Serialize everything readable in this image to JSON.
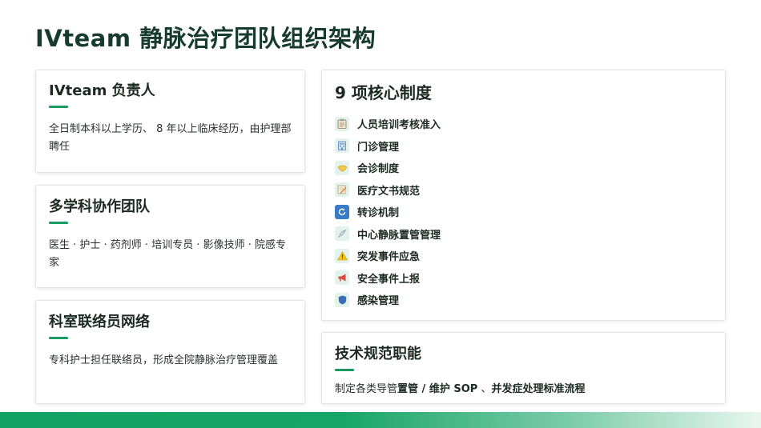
{
  "title": "IVteam 静脉治疗团队组织架构",
  "lead": {
    "title": "IVteam 负责人",
    "text": "全日制本科以上学历、 8 年以上临床经历，由护理部聘任"
  },
  "mdt": {
    "title": "多学科协作团队",
    "text": "医生 · 护士 · 药剂师 · 培训专员 · 影像技师 · 院感专家"
  },
  "liaison": {
    "title": "科室联络员网络",
    "text": "专科护士担任联络员，形成全院静脉治疗管理覆盖"
  },
  "rules": {
    "title": "9 项核心制度",
    "items": [
      {
        "label": "人员培训考核准入",
        "icon": "clipboard-icon"
      },
      {
        "label": "门诊管理",
        "icon": "hospital-icon"
      },
      {
        "label": "会诊制度",
        "icon": "handshake-icon"
      },
      {
        "label": "医疗文书规范",
        "icon": "memo-icon"
      },
      {
        "label": "转诊机制",
        "icon": "refresh-icon"
      },
      {
        "label": "中心静脉置管管理",
        "icon": "syringe-icon"
      },
      {
        "label": "突发事件应急",
        "icon": "warning-icon"
      },
      {
        "label": "安全事件上报",
        "icon": "megaphone-icon"
      },
      {
        "label": "感染管理",
        "icon": "shield-icon"
      }
    ]
  },
  "tech": {
    "title": "技术规范职能",
    "text_prefix": "制定各类导管",
    "text_strong": "置管 / 维护 SOP",
    "text_sep": " 、",
    "text_strong2": "并发症处理标准流程"
  },
  "colors": {
    "accent": "#1a9a63",
    "title": "#173b2e"
  }
}
